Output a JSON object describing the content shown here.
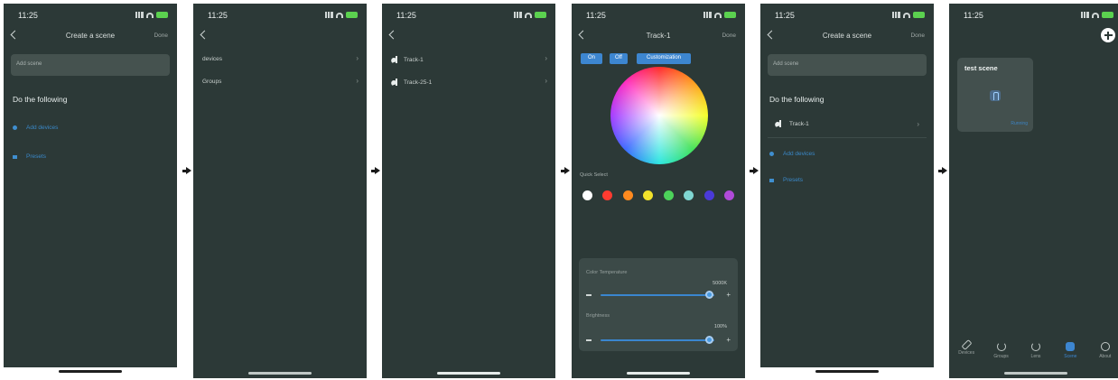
{
  "status": {
    "time": "11:25"
  },
  "create_scene": {
    "title": "Create a scene",
    "done": "Done",
    "name_placeholder": "Add scene",
    "section": "Do the following",
    "add_devices": "Add devices",
    "presets": "Presets"
  },
  "picker": {
    "devices": "devices",
    "groups": "Groups"
  },
  "device_list": [
    "Track-1",
    "Track-25-1"
  ],
  "color": {
    "title": "Track-1",
    "done": "Done",
    "modes": [
      "On",
      "Off",
      "Customization"
    ],
    "quick_select": "Quick Select",
    "swatches": [
      "#ffffff",
      "#ff3b30",
      "#ff8a1f",
      "#f2e22b",
      "#4cd35a",
      "#7fd6d2",
      "#4a3ad8",
      "#b04ad8"
    ],
    "temp_label": "Color Temperature",
    "temp_value": "5000K",
    "temp_level": 0.95,
    "bright_label": "Brightness",
    "bright_value": "100%",
    "bright_level": 0.95
  },
  "scene_result": {
    "added_device": "Track-1"
  },
  "home": {
    "card_title": "test scene",
    "card_sub": "Running",
    "tabs": [
      "Devices",
      "Groups",
      "Lens",
      "Scene",
      "About"
    ],
    "active_tab": 3
  },
  "colors": {
    "bg": "#2c3937",
    "accent": "#3d86d0"
  }
}
